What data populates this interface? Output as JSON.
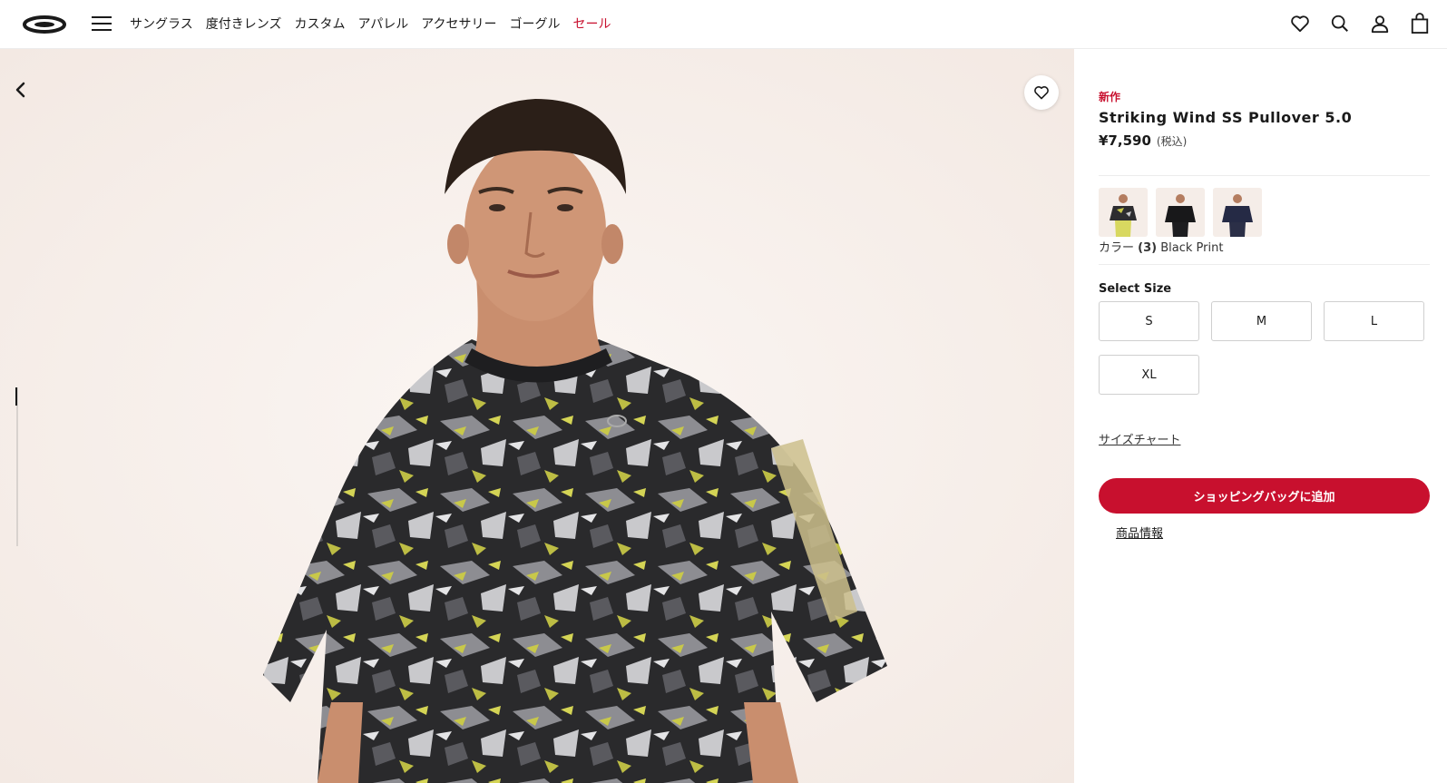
{
  "header": {
    "logo": "oakley-ellipse-logo",
    "nav": [
      {
        "label": "サングラス"
      },
      {
        "label": "度付きレンズ"
      },
      {
        "label": "カスタム"
      },
      {
        "label": "アパレル"
      },
      {
        "label": "アクセサリー"
      },
      {
        "label": "ゴーグル"
      },
      {
        "label": "セール"
      }
    ],
    "icons": [
      "heart-icon",
      "search-icon",
      "user-icon",
      "bag-icon"
    ]
  },
  "gallery": {
    "image": "model wearing black print pullover"
  },
  "product": {
    "badge": "新作",
    "title": "Striking Wind SS Pullover 5.0",
    "price": "¥7,590",
    "tax": "(税込)",
    "color_label": "カラー",
    "color_count": "(3)",
    "color_name": "Black Print",
    "swatches": [
      "Black Print",
      "Black",
      "Navy"
    ],
    "size_label": "Select Size",
    "sizes": [
      "S",
      "M",
      "L",
      "XL"
    ],
    "size_chart": "サイズチャート",
    "add_to_bag": "ショッピングバッグに追加",
    "product_info": "商品情報"
  },
  "colors": {
    "accent": "#c8102e",
    "gallery_bg": "#f8f2ee"
  }
}
